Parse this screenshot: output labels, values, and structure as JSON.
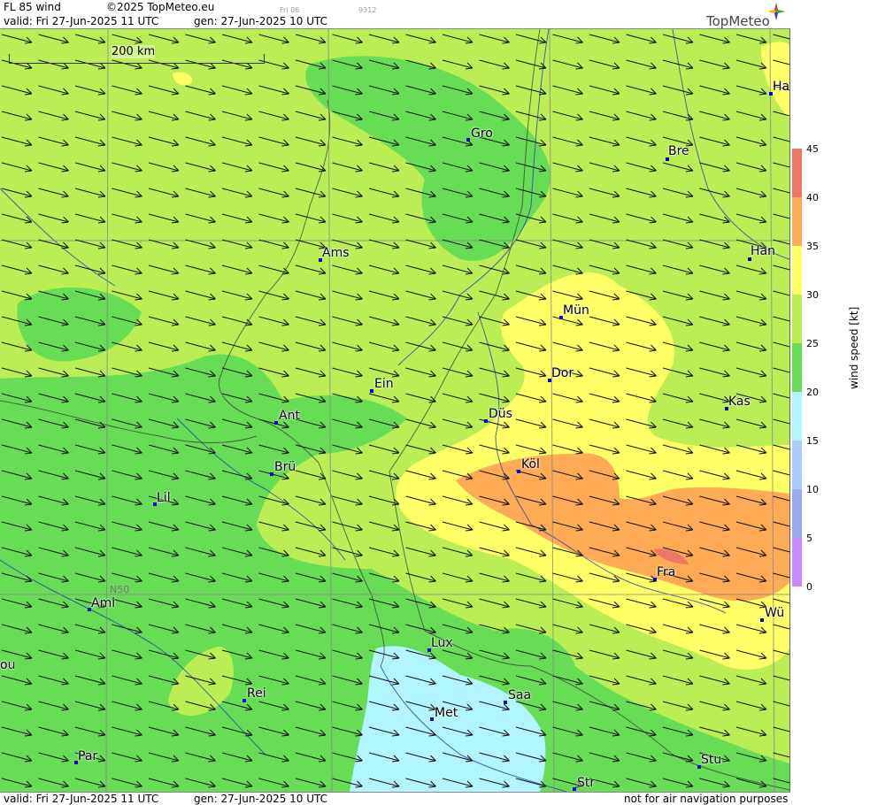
{
  "header": {
    "product": "FL 85 wind",
    "copyright": "©2025 TopMeteo.eu",
    "valid": "valid:  Fri  27-Jun-2025  11 UTC",
    "gen": "gen: 27-Jun-2025 10 UTC",
    "small_day": "Fri 06",
    "small_code": "9312",
    "logo": "TopMeteo"
  },
  "footer": {
    "valid": "valid:  Fri  27-Jun-2025  11 UTC",
    "gen": "gen: 27-Jun-2025 10 UTC",
    "disclaimer": "not for air navigation purposes"
  },
  "scale": {
    "label": "200 km"
  },
  "grid_label": "N50",
  "colorbar": {
    "title": "wind speed [kt]",
    "ticks": [
      "0",
      "5",
      "10",
      "15",
      "20",
      "25",
      "30",
      "35",
      "40",
      "45"
    ],
    "colors": [
      "#cc88ff",
      "#9988ee",
      "#99aaee",
      "#aaccff",
      "#b0f5ff",
      "#66dd55",
      "#bbee55",
      "#ffff66",
      "#ffaa55",
      "#ee7766"
    ]
  },
  "cities": [
    {
      "name": "Gro"
    },
    {
      "name": "Bre"
    },
    {
      "name": "Ha"
    },
    {
      "name": "Ams"
    },
    {
      "name": "Han"
    },
    {
      "name": "Mün"
    },
    {
      "name": "Dor"
    },
    {
      "name": "Ein"
    },
    {
      "name": "Kas"
    },
    {
      "name": "Düs"
    },
    {
      "name": "Ant"
    },
    {
      "name": "Köl"
    },
    {
      "name": "Brü"
    },
    {
      "name": "Lil"
    },
    {
      "name": "Fra"
    },
    {
      "name": "Ami"
    },
    {
      "name": "Wü"
    },
    {
      "name": "Lux"
    },
    {
      "name": "ou"
    },
    {
      "name": "Rei"
    },
    {
      "name": "Saa"
    },
    {
      "name": "Met"
    },
    {
      "name": "Par"
    },
    {
      "name": "Stu"
    },
    {
      "name": "Str"
    }
  ]
}
